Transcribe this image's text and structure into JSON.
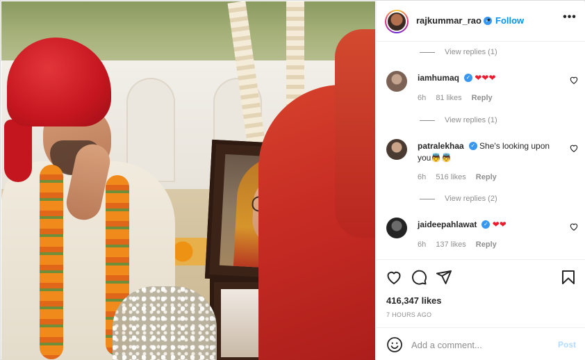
{
  "post": {
    "author": "rajkummar_rao",
    "follow_label": "Follow",
    "separator": "•",
    "more_label": "•••",
    "likes": "416,347 likes",
    "time": "7 HOURS AGO"
  },
  "comments": [
    {
      "view_replies_above": "View replies (1)",
      "username": "iamhumaq",
      "text": "❤❤❤",
      "age": "6h",
      "likes": "81 likes",
      "reply_label": "Reply"
    },
    {
      "view_replies_above": "View replies (1)",
      "username": "patralekhaa",
      "text": "She's looking upon you👼👼",
      "age": "6h",
      "likes": "516 likes",
      "reply_label": "Reply"
    },
    {
      "view_replies_above": "View replies (2)",
      "username": "jaideepahlawat",
      "text": "❤❤",
      "age": "6h",
      "likes": "137 likes",
      "reply_label": "Reply"
    }
  ],
  "composer": {
    "placeholder": "Add a comment...",
    "post_label": "Post"
  },
  "icons": [
    "heart-icon",
    "comment-icon",
    "share-icon",
    "bookmark-icon",
    "emoji-icon",
    "verified-icon"
  ],
  "colors": {
    "accent": "#0095f6",
    "verified": "#3897f0",
    "post_disabled": "#b3dbff",
    "muted": "#8e8e8e"
  }
}
